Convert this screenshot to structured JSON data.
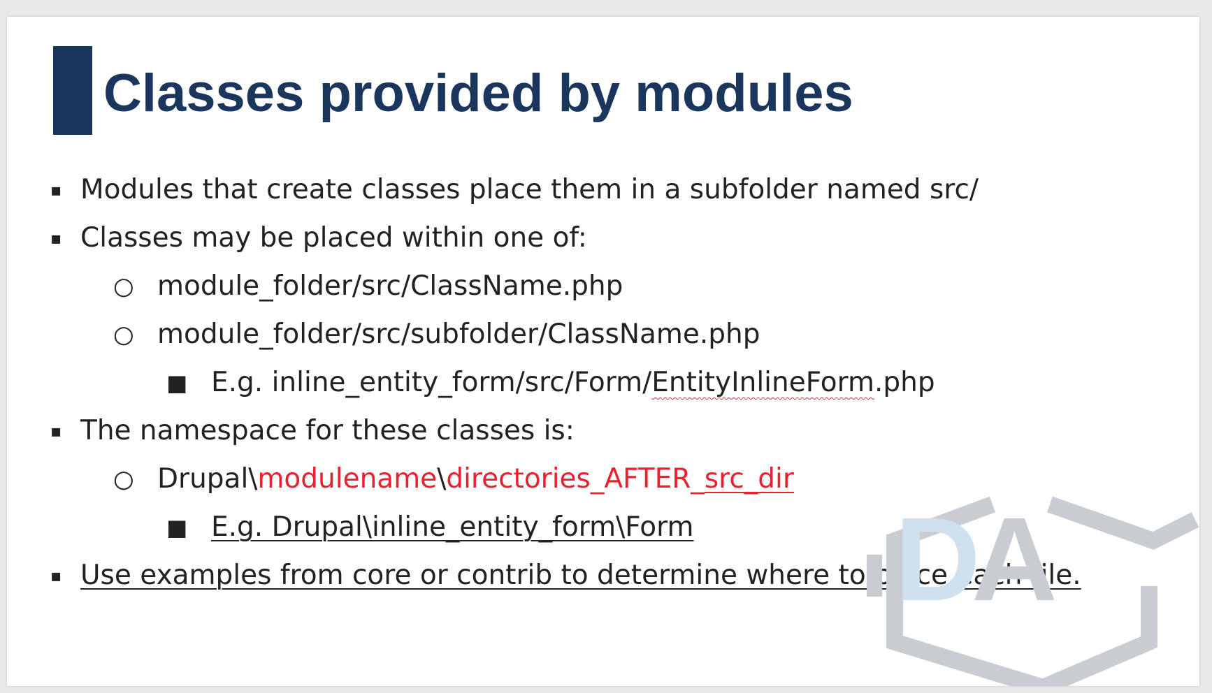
{
  "title": "Classes provided by modules",
  "bullets": [
    {
      "marker": "▪",
      "text": "Modules that create classes place them in a subfolder named src/"
    },
    {
      "marker": "▪",
      "text": "Classes may be placed within one of:"
    },
    {
      "marker": "○",
      "text": "module_folder/src/ClassName.php"
    },
    {
      "marker": "○",
      "text": "module_folder/src/subfolder/ClassName.php"
    },
    {
      "marker": "■",
      "text_a": "E.g. inline_entity_form/src/Form/",
      "text_b": "EntityInlineForm",
      "text_c": ".php"
    },
    {
      "marker": "▪",
      "text": "The namespace for these classes is:"
    },
    {
      "marker": "○",
      "text_a": "Drupal\\",
      "text_b": "modulename",
      "text_c": "\\",
      "text_d": "directories_AFTER_",
      "text_e": "src_dir"
    },
    {
      "marker": "■",
      "text": "E.g. Drupal\\inline_entity_form\\Form"
    },
    {
      "marker": "▪",
      "text": "Use examples from core or contrib to determine where to place each file."
    }
  ],
  "logo": {
    "letters": "DA",
    "icon": "drupal-association-watermark-logo",
    "colors": {
      "hex": "#c9cdd2",
      "d": "#cfe0ef"
    }
  },
  "colors": {
    "title": "#1b365d",
    "accent_red": "#e8222e",
    "text": "#222222"
  }
}
